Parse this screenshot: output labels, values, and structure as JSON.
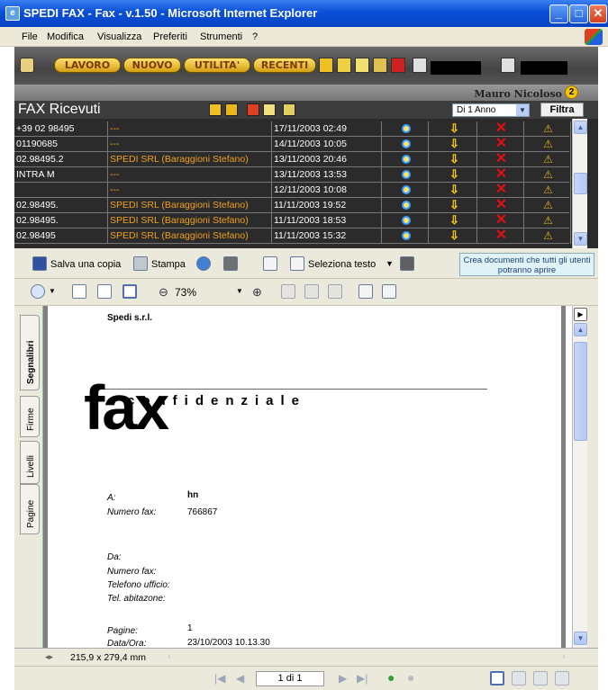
{
  "window": {
    "title": "SPEDI FAX - Fax - v.1.50 - Microsoft Internet Explorer"
  },
  "menu": {
    "items": [
      "File",
      "Modifica",
      "Visualizza",
      "Preferiti",
      "Strumenti",
      "?"
    ]
  },
  "appbar": {
    "buttons": [
      "LAVORO",
      "NUOVO",
      "UTILITA'",
      "RECENTI"
    ]
  },
  "user": {
    "name": "Mauro Nicoloso",
    "badge": "2"
  },
  "fax_panel": {
    "title": "FAX Ricevuti",
    "period": "Di 1 Anno",
    "filter_label": "Filtra",
    "rows": [
      {
        "number": "+39 02 98495",
        "sender": "---",
        "date": "17/11/2003 02:49"
      },
      {
        "number": "01190685",
        "sender": "---",
        "date": "14/11/2003 10:05"
      },
      {
        "number": "02.98495.2",
        "sender": "SPEDI SRL (Baraggioni Stefano)",
        "date": "13/11/2003 20:46"
      },
      {
        "number": "INTRA    M",
        "sender": "---",
        "date": "13/11/2003 13:53"
      },
      {
        "number": "",
        "sender": "---",
        "date": "12/11/2003 10:08"
      },
      {
        "number": "02.98495.",
        "sender": "SPEDI SRL (Baraggioni Stefano)",
        "date": "11/11/2003 19:52"
      },
      {
        "number": "02.98495.",
        "sender": "SPEDI SRL (Baraggioni Stefano)",
        "date": "11/11/2003 18:53"
      },
      {
        "number": "02.98495",
        "sender": "SPEDI SRL (Baraggioni Stefano)",
        "date": "11/11/2003 15:32"
      }
    ]
  },
  "pdf_toolbar": {
    "save_label": "Salva una copia",
    "print_label": "Stampa",
    "select_text_label": "Seleziona testo",
    "hint": "Crea documenti che tutti gli utenti potranno aprire",
    "zoom": "73%"
  },
  "side_tabs": [
    "Segnalibri",
    "Firme",
    "Livelli",
    "Pagine"
  ],
  "document": {
    "company": "Spedi s.r.l.",
    "fax_big": "fax",
    "confidential": "confidenziale",
    "to_label": "A:",
    "to_value": "hn",
    "faxnum_label": "Numero fax:",
    "faxnum_value": "766867",
    "from_label": "Da:",
    "from_faxnum_label": "Numero fax:",
    "office_phone_label": "Telefono ufficio:",
    "home_phone_label": "Tel. abitazone:",
    "pages_label": "Pagine:",
    "pages_value": "1",
    "datetime_label": "Data/Ora:",
    "datetime_value": "23/10/2003 10.13.30"
  },
  "status": {
    "page_size": "215,9 x 279,4 mm",
    "page_of": "1 di 1"
  }
}
